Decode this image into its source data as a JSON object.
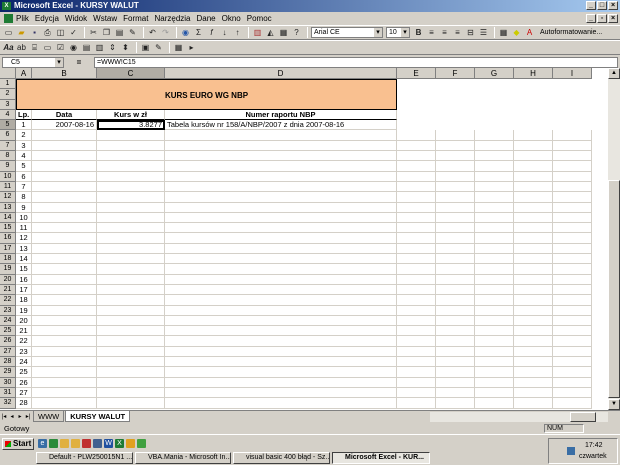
{
  "window": {
    "title": "Microsoft Excel - KURSY WALUT",
    "app_icon": "X"
  },
  "menu": [
    "Plik",
    "Edycja",
    "Widok",
    "Wstaw",
    "Format",
    "Narzędzia",
    "Dane",
    "Okno",
    "Pomoc"
  ],
  "toolbar": {
    "font_name": "Arial CE",
    "font_size": "10",
    "autoformat_label": "Autoformatowanie...",
    "bold": "B"
  },
  "formula_bar": {
    "name_box": "C5",
    "eq": "=",
    "formula": "=WWW!C15"
  },
  "columns": [
    "A",
    "B",
    "C",
    "D",
    "E",
    "F",
    "G",
    "H",
    "I"
  ],
  "sheet": {
    "title": "KURS EURO WG NBP",
    "headers": {
      "lp": "Lp.",
      "date": "Data",
      "rate": "Kurs w zł",
      "report": "Numer raportu NBP"
    },
    "first_row": {
      "lp": "1",
      "date": "2007-08-16",
      "rate": "3.8277",
      "report": "Tabela kursów nr 158/A/NBP/2007 z dnia 2007-08-16"
    },
    "lp_numbers": [
      "2",
      "3",
      "4",
      "5",
      "6",
      "7",
      "8",
      "9",
      "10",
      "11",
      "12",
      "13",
      "14",
      "15",
      "16",
      "17",
      "18",
      "19",
      "20",
      "21",
      "22",
      "23",
      "24",
      "25",
      "26",
      "27",
      "28"
    ]
  },
  "row_numbers": [
    "1",
    "2",
    "3",
    "4",
    "5",
    "6",
    "7",
    "8",
    "9",
    "10",
    "11",
    "12",
    "13",
    "14",
    "15",
    "16",
    "17",
    "18",
    "19",
    "20",
    "21",
    "22",
    "23",
    "24",
    "25",
    "26",
    "27",
    "28",
    "29",
    "30",
    "31",
    "32"
  ],
  "tabs": [
    "WWW",
    "KURSY WALUT"
  ],
  "status": {
    "left": "Gotowy",
    "num": "NUM"
  },
  "taskbar": {
    "start": "Start",
    "buttons": [
      "Default - PLW250015N1 ...",
      "VBA.Mania - Microsoft In...",
      "visual basic 400 błąd - Sz...",
      "Microsoft Excel - KUR..."
    ],
    "time": "17:42",
    "day": "czwartek"
  }
}
